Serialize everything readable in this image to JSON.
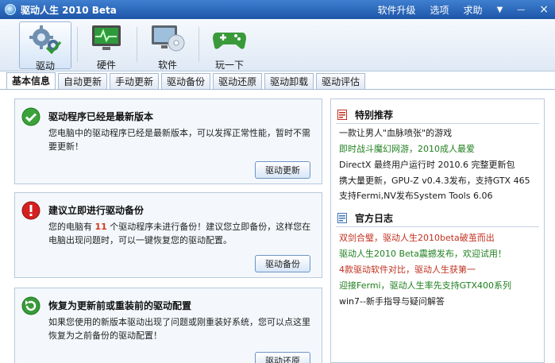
{
  "window": {
    "title": "驱动人生 2010 Beta",
    "menu": [
      "软件升级",
      "选项",
      "求助"
    ],
    "controls": {
      "dropdown": "▼",
      "minimize": "—",
      "close": "×"
    }
  },
  "toolbar": {
    "items": [
      {
        "label": "驱动",
        "icon": "gears-icon"
      },
      {
        "label": "硬件",
        "icon": "monitor-pulse-icon"
      },
      {
        "label": "软件",
        "icon": "monitor-disc-icon"
      },
      {
        "label": "玩一下",
        "icon": "gamepad-icon"
      }
    ]
  },
  "tabs": [
    "基本信息",
    "自动更新",
    "手动更新",
    "驱动备份",
    "驱动还原",
    "驱动卸载",
    "驱动评估"
  ],
  "cards": {
    "latest": {
      "title": "驱动程序已经是最新版本",
      "text": "您电脑中的驱动程序已经是最新版本，可以发挥正常性能，暂时不需要更新！",
      "button": "驱动更新"
    },
    "backup": {
      "title": "建议立即进行驱动备份",
      "text_before": "您的电脑有 ",
      "count": "11",
      "text_after": " 个驱动程序未进行备份！建议您立即备份，这样您在电脑出现问题时，可以一键恢复您的驱动配置。",
      "button": "驱动备份"
    },
    "restore": {
      "title": "恢复为更新前或重装前的驱动配置",
      "text": "如果您使用的新版本驱动出现了问题或刚重装好系统，您可以点这里恢复为之前备份的驱动配置！",
      "button": "驱动还原"
    }
  },
  "recommend": {
    "title": "特别推荐",
    "items": [
      {
        "text": "一款让男人\"血脉喷张\"的游戏",
        "color": "#1a1a1a"
      },
      {
        "text": "即时战斗魔幻网游，2010成人最爱",
        "color": "#1e7f1e"
      },
      {
        "text": "DirectX 最终用户运行时 2010.6 完整更新包",
        "color": "#1a1a1a"
      },
      {
        "text": "携大量更新，GPU-Z v0.4.3发布，支持GTX 465",
        "color": "#1a1a1a"
      },
      {
        "text": "支持Fermi,NV发布System Tools 6.06",
        "color": "#1a1a1a"
      }
    ]
  },
  "blog": {
    "title": "官方日志",
    "items": [
      {
        "text": "双剑合璧，驱动人生2010beta破茧而出",
        "color": "#c0301f"
      },
      {
        "text": "驱动人生2010 Beta震撼发布，欢迎试用！",
        "color": "#1e7f1e"
      },
      {
        "text": "4款驱动软件对比，驱动人生获第一",
        "color": "#c0301f"
      },
      {
        "text": "迎接Fermi，驱动人生率先支持GTX400系列",
        "color": "#1e7f1e"
      },
      {
        "text": "win7--新手指导与疑问解答",
        "color": "#1a1a1a"
      }
    ]
  }
}
